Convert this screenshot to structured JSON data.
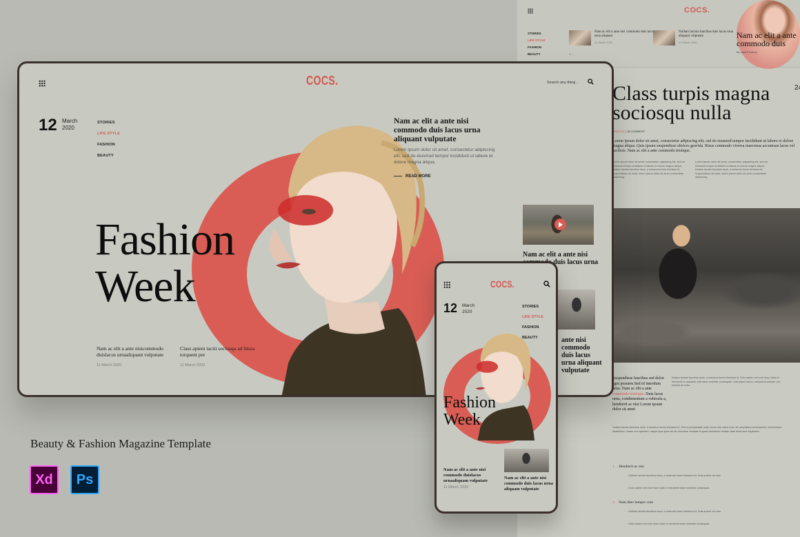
{
  "brand": {
    "logo": "COCS.",
    "accent": "#d95d54"
  },
  "nav": [
    "STORIES",
    "LIFE STYLE",
    "FASHION",
    "BEAUTY"
  ],
  "nav_active_index": 1,
  "date": {
    "day": "12",
    "month": "March",
    "year": "2020"
  },
  "tablet": {
    "search_placeholder": "Search any thing ..",
    "headline_line1": "Fashion",
    "headline_line2": "Week",
    "side_title": "Nam ac elit a ante nisi commodo duis lacus urna aliquant vulputate",
    "side_text": "Lorem ipsum dolor sit amet, consectetur adipiscing elit, sed do eiusmod tempor incididunt ut labore et dolore magna aliqua.",
    "read_more": "READ MORE",
    "thumb_title_1": "Nam ac elit a ante nisi commodo duis lacus urna",
    "thumb_title_2": "ante nisi commodo duis lacus urna aliquant vulputate",
    "stories": [
      {
        "title": "Nam ac elit a ante nisicommodo duislacus urnaaliquant vulputate",
        "date": "11 March 2020"
      },
      {
        "title": "Class aptent taciti sociosqu ad litora torquent per",
        "date": "11 March 2020"
      }
    ]
  },
  "phone": {
    "headline_line1": "Fashion",
    "headline_line2": "Week",
    "story_title": "Nam ac elit a ante nisi commodo duislacus urnaaliquam vulputate",
    "story_date": "11 March 2020",
    "thumb_title": "Nam ac elit a ante nisi commodo duis lacus urna aliquam vulputate"
  },
  "article": {
    "hero_title": "Nam ac elit a ante commodo duis",
    "hero_byline": "By Jack Fennery",
    "top_cards": [
      {
        "title": "Nam ac elit a ante nisi commodo duis lacus urna aliquant",
        "date": "11 March 2020"
      },
      {
        "title": "Nullam lacinia faucibus duis lacus urna aliquant vulputate",
        "date": "11 March 2020"
      }
    ],
    "title": "Class turpis magna sociosqu nulla",
    "page_number": "24",
    "meta_category": "FASHION",
    "meta_comments": "18 COMMENT",
    "lead": "Lorem ipsum dolor sit amet, consectetur adipiscing elit, sed do eiusmod tempor incididunt ut labore et dolore magna aliqua. Quis ipsum suspendisse ultrices gravida. Risus commodo viverra maecenas accumsan lacus vel facilisis. Nam ac elit a ante commodo tristique.",
    "col_text": "Lorem ipsum dolor sit amet, consectetur adipiscing elit, sed do eiusmod tempor incididunt ut labore et dolore magna aliqua. Nullam lacinia faucibus risus, a euismod lorem tincidunt id. Suspendisse sit amet, lorem ipsum dolor sit amet consectetur adipiscing.",
    "quote_before": "Suspendisse faucibus sed dolor eget posuere.Sed id interdum urna. Nam ac elit a ante ",
    "quote_link": "commodo tristique",
    "quote_after": ". Duis lacus urna, condimentum a vehicula a, hendrerit ac nisi Lorem ipsum dolor sit amet",
    "right_text": "Nullam lacinia faucibus risus, a euismod lorem tincidunt id. Duis autem vel eum iriure dolor in hendrerit in vulputate velit esse molestie consequat. Cras ipsum lacus, volutpat ut semper vel, lobortis at tortor.",
    "full_text": "Nullam lacinia faucibus risus, a euismod lorem tincidunt id. Sed ut perspiciatis unde omnis iste natus error sit voluptatem accusantium doloremque laudantium, totam rem aperiam, eaque ipsa quae ab illo inventore veritatis et quasi architecto beatae vitae dicta sunt explicabo.",
    "list": [
      {
        "num": "1.",
        "title": "Hendrerit ac nisi",
        "bullets": [
          "Nullam lacinia faucibus risus, a euismod lorem tincidunt id. Duis autem vel eum",
          "Duis autem vel eum iriure dolor in hendrerit esse molestie consequat."
        ]
      },
      {
        "num": "2.",
        "title": "Nam liber tempor cum",
        "bullets": [
          "Nullam lacinia faucibus risus, a euismod lorem tincidunt id. Duis autem vel eum",
          "Duis autem vel eum iriure dolor in hendrerit esse molestie consequat."
        ]
      }
    ]
  },
  "caption": "Beauty & Fashion Magazine Template",
  "apps": [
    {
      "label": "Xd",
      "icon": "adobe-xd-icon",
      "color": "#ff61f6"
    },
    {
      "label": "Ps",
      "icon": "adobe-photoshop-icon",
      "color": "#31a8ff"
    }
  ]
}
